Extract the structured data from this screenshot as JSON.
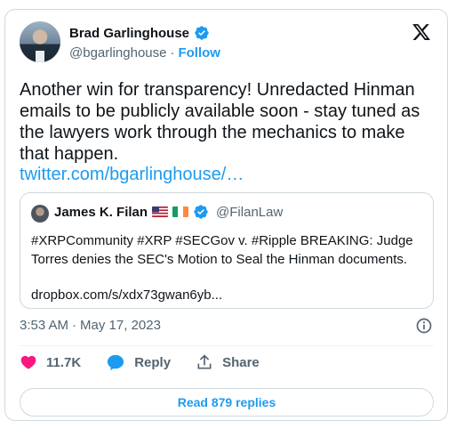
{
  "author": {
    "name": "Brad Garlinghouse",
    "handle": "@bgarlinghouse",
    "separator": "·",
    "follow_label": "Follow"
  },
  "tweet": {
    "text": "Another win for transparency! Unredacted Hinman emails to be publicly available soon - stay tuned as the lawyers work through the mechanics to make that happen.",
    "link": "twitter.com/bgarlinghouse/…"
  },
  "quote": {
    "name": "James K. Filan",
    "handle": "@FilanLaw",
    "text": "#XRPCommunity #XRP #SECGov v. #Ripple BREAKING:  Judge Torres denies the SEC's Motion to Seal the Hinman documents.",
    "link": "dropbox.com/s/xdx73gwan6yb..."
  },
  "meta": {
    "time": "3:53 AM",
    "separator": "·",
    "date": "May 17, 2023"
  },
  "actions": {
    "likes": "11.7K",
    "reply_label": "Reply",
    "share_label": "Share"
  },
  "read_replies_label": "Read 879 replies",
  "colors": {
    "accent": "#1d9bf0",
    "like": "#f91880",
    "text": "#0f1419",
    "secondary": "#536471",
    "border": "#cfd9de"
  },
  "icons": [
    "verified-badge-icon",
    "x-logo-icon",
    "us-flag-icon",
    "ireland-flag-icon",
    "info-icon",
    "heart-icon",
    "reply-bubble-icon",
    "share-icon"
  ]
}
